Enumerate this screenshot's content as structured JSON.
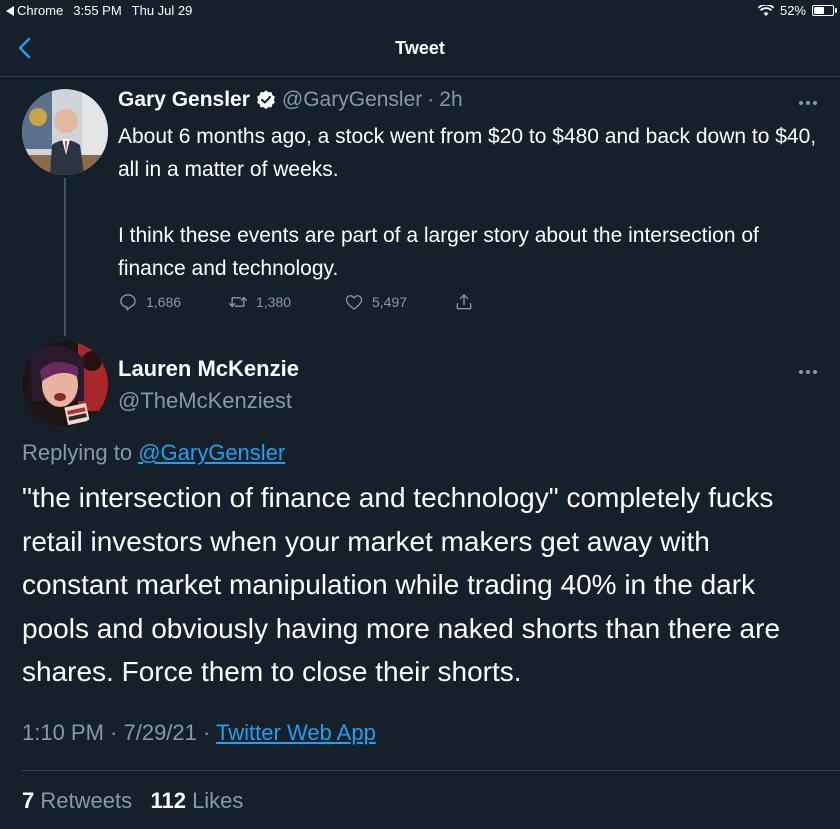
{
  "status_bar": {
    "back_app": "Chrome",
    "time": "3:55 PM",
    "date": "Thu Jul 29",
    "battery": "52%",
    "battery_level": 0.52
  },
  "header": {
    "title": "Tweet"
  },
  "parent_tweet": {
    "name": "Gary Gensler",
    "handle": "@GaryGensler",
    "separator": "·",
    "time": "2h",
    "paragraphs": [
      "About 6 months ago, a stock went from $20 to $480 and back down to $40, all in a matter of weeks.",
      "I think these events are part of a larger story about the intersection of finance and technology."
    ],
    "replies": "1,686",
    "retweets": "1,380",
    "likes": "5,497"
  },
  "main_tweet": {
    "name": "Lauren McKenzie",
    "handle": "@TheMcKenziest",
    "replying_prefix": "Replying to",
    "replying_to": "@GaryGensler",
    "text": "\"the intersection of finance and technology\" completely fucks retail investors when your market makers get away with constant market manipulation while trading 40% in the dark pools and obviously having more naked shorts than there are shares. Force them to close their shorts.",
    "timestamp": "1:10 PM · 7/29/21 ·",
    "source": "Twitter Web App",
    "retweet_count": "7",
    "retweet_label": "Retweets",
    "like_count": "112",
    "like_label": "Likes"
  },
  "colors": {
    "background": "#15202b",
    "secondary_text": "#8899a6",
    "link": "#1da1f2",
    "border": "#38444d"
  }
}
